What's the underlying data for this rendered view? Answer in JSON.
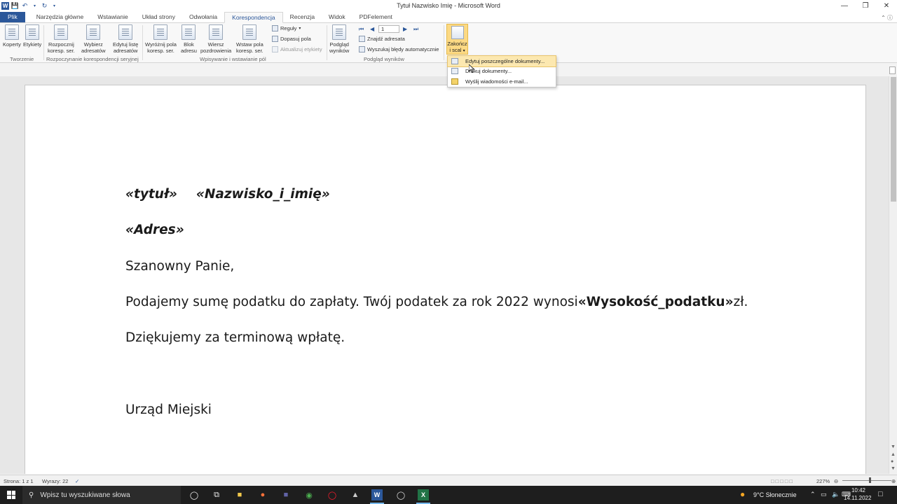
{
  "window": {
    "title": "Tytuł   Nazwisko Imię  -  Microsoft Word",
    "app_icon": "W"
  },
  "tabs": [
    "Plik",
    "Narzędzia główne",
    "Wstawianie",
    "Układ strony",
    "Odwołania",
    "Korespondencja",
    "Recenzja",
    "Widok",
    "PDFelement"
  ],
  "ribbon": {
    "koperty": "Koperty",
    "etykiety": "Etykiety",
    "rozpocznij_1": "Rozpocznij",
    "rozpocznij_2": "koresp. ser.",
    "wybierz_1": "Wybierz",
    "wybierz_2": "adresatów",
    "edytuj_1": "Edytuj listę",
    "edytuj_2": "adresatów",
    "wyroznij_1": "Wyróżnij pola",
    "wyroznij_2": "koresp. ser.",
    "blok_1": "Blok",
    "blok_2": "adresu",
    "wiersz_1": "Wiersz",
    "wiersz_2": "pozdrowienia",
    "wstaw_1": "Wstaw pola",
    "wstaw_2": "koresp. ser.",
    "reguly": "Reguły",
    "dopasuj": "Dopasuj pola",
    "aktualizuj": "Aktualizuj etykiety",
    "podglad_1": "Podgląd",
    "podglad_2": "wyników",
    "record_number": "1",
    "znajdz": "Znajdź adresata",
    "wyszukaj": "Wyszukaj błędy automatycznie",
    "zakoncz_1": "Zakończ",
    "zakoncz_2": "i scal",
    "groups": {
      "tworzenie": "Tworzenie",
      "rozpoczynanie": "Rozpoczynanie korespondencji seryjnej",
      "wpisywanie": "Wpisywanie i wstawianie pól",
      "podglad": "Podgląd wyników"
    }
  },
  "menu": {
    "items": [
      "Edytuj poszczególne dokumenty...",
      "Drukuj dokumenty...",
      "Wyślij wiadomości e-mail..."
    ]
  },
  "document": {
    "field_title": "«tytuł»",
    "field_name": "«Nazwisko_i_imię»",
    "field_address": "«Adres»",
    "greeting": "Szanowny Panie,",
    "body_pre": "Podajemy sumę podatku do zapłaty. Twój podatek za rok 2022 wynosi",
    "field_tax": "«Wysokość_podatku»",
    "body_post": "zł.",
    "thanks": "Dziękujemy za terminową wpłatę.",
    "signature": "Urząd Miejski"
  },
  "status": {
    "page": "Strona: 1 z 1",
    "words": "Wyrazy: 22",
    "zoom": "227%"
  },
  "taskbar": {
    "search_placeholder": "Wpisz tu wyszukiwane słowa",
    "weather": "9°C  Słonecznie",
    "time": "10:42",
    "date": "14.11.2022"
  },
  "colors": {
    "word_blue": "#2b579a",
    "menu_highlight": "#fce8b0",
    "finish_button": "#fcd984"
  }
}
